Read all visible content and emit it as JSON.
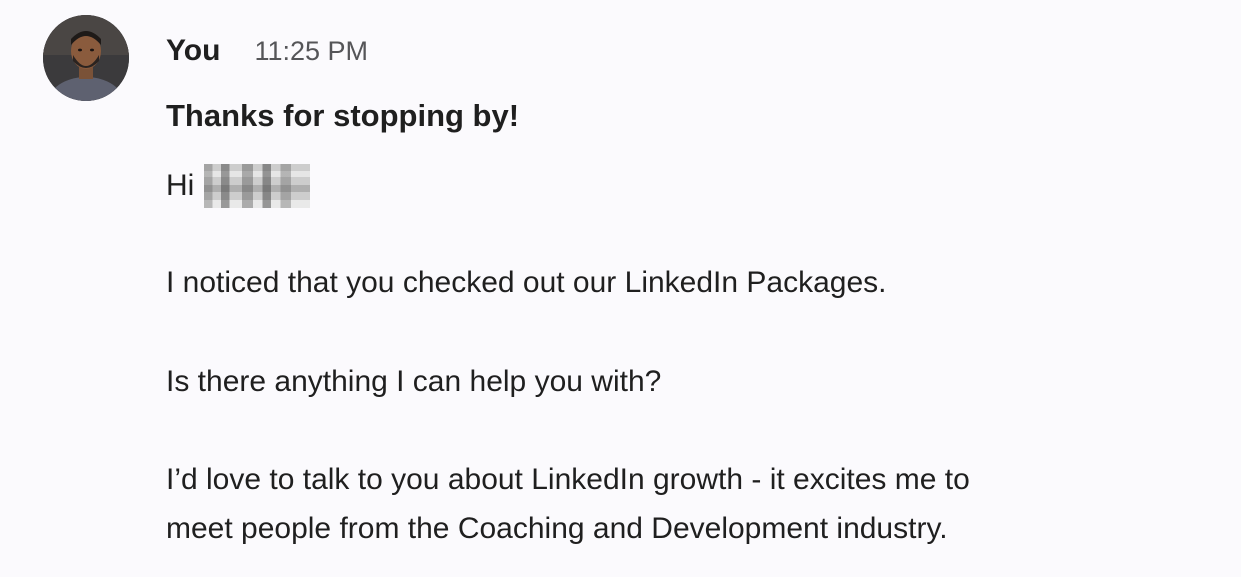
{
  "message": {
    "sender": "You",
    "time": "11:25 PM",
    "subject": "Thanks for stopping by!",
    "greeting": "Hi",
    "paragraph_1": "I noticed that you checked out our LinkedIn Packages.",
    "paragraph_2": "Is there anything I can help you with?",
    "paragraph_3_line_1": "I’d love to talk to you about LinkedIn growth - it excites me to",
    "paragraph_3_line_2": "meet people from the Coaching and Development industry."
  },
  "colors": {
    "background": "#fbfafd",
    "text": "#1f1f1f",
    "timestamp": "#555558"
  },
  "icons": {
    "avatar": "user-avatar-photo",
    "redaction": "blurred-name-redaction"
  }
}
